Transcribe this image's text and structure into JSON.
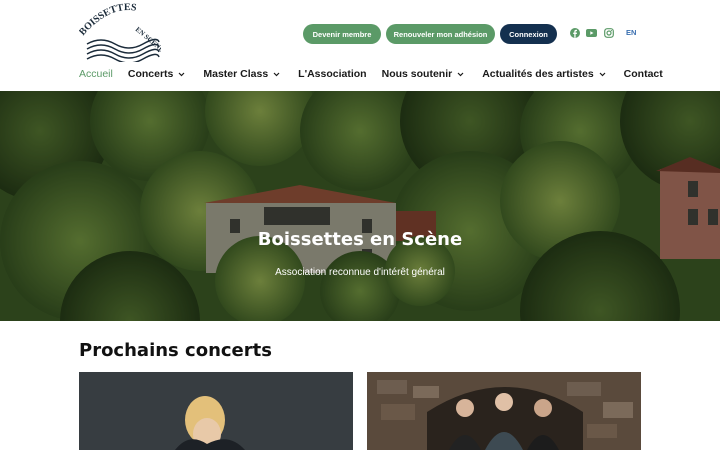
{
  "logo": {
    "text_top": "BOISSETTES",
    "text_right": "EN SCÈNE",
    "alt": "Boissettes en Scène"
  },
  "top_actions": {
    "become_member": "Devenir membre",
    "renew": "Renouveler mon adhésion",
    "login": "Connexion"
  },
  "social": [
    "facebook-icon",
    "youtube-icon",
    "instagram-icon"
  ],
  "lang": "EN",
  "nav": {
    "items": [
      {
        "label": "Accueil",
        "active": true,
        "dropdown": false
      },
      {
        "label": "Concerts",
        "active": false,
        "dropdown": true
      },
      {
        "label": "Master Class",
        "active": false,
        "dropdown": true
      },
      {
        "label": "L'Association",
        "active": false,
        "dropdown": false
      },
      {
        "label": "Nous soutenir",
        "active": false,
        "dropdown": true
      },
      {
        "label": "Actualités des artistes",
        "active": false,
        "dropdown": true
      },
      {
        "label": "Contact",
        "active": false,
        "dropdown": false
      }
    ]
  },
  "hero": {
    "title": "Boissettes en Scène",
    "subtitle": "Association reconnue d'intérêt général"
  },
  "concerts": {
    "title": "Prochains concerts"
  },
  "colors": {
    "accent_green": "#5b9a67",
    "navy": "#14304f",
    "lang_blue": "#3a6fb0"
  }
}
